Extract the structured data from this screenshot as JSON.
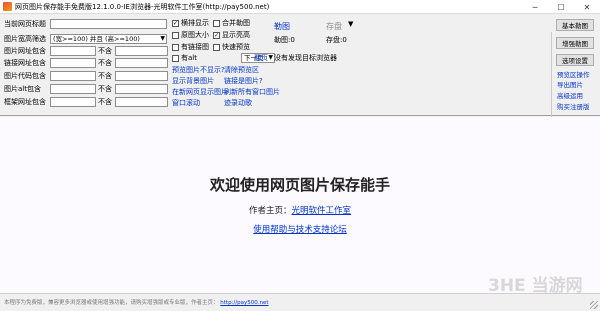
{
  "window": {
    "title": "网页图片保存能手免费版12.1.0.0-IE浏览器-光明软件工作室(http://pay500.net)",
    "min": "─",
    "max": "☐",
    "close": "✕"
  },
  "fields": {
    "url_label": "当前网页标题",
    "size_filter_label": "图片宽高筛选",
    "size_filter_value": "(宽>=100) 并且 (高>=100)",
    "img_url_contains_label": "图片网址包含",
    "link_url_contains_label": "链接网址包含",
    "img_code_contains_label": "图片代码包含",
    "img_alt_contains_label": "图片alt包含",
    "frame_url_contains_label": "框架网址包含",
    "not_contains": "不含"
  },
  "options": {
    "hide_display": "横排显示",
    "original_size": "原图大小",
    "link_thumbnail": "有链接图",
    "alt_text": "有alt",
    "merge_images": "合并勒图",
    "show_highlight": "显示亮高",
    "quick_preview": "快速预览",
    "page_select": "下一页",
    "next_link": "翻页",
    "hide_display_checked": true,
    "original_size_checked": false,
    "link_thumbnail_checked": false,
    "alt_text_checked": false,
    "merge_images_checked": false,
    "show_highlight_checked": true,
    "quick_preview_checked": false
  },
  "links": {
    "view_preview": "预览图片不显示?",
    "clear_preview": "清除预览区",
    "show_bg_images": "显示背景图片",
    "link_is_image": "链接是图片?",
    "show_in_new_window": "在新网页显示图片",
    "refresh_new_window": "刷新所有窗口图片",
    "window_scroll": "窗口滚动",
    "auto_scroll": "迹录动歌"
  },
  "status": {
    "grab_label": "勒图",
    "grab_count": "勒图:0",
    "save_label": "存盘",
    "save_count": "存盘:0",
    "no_target": "没有发现目标浏览器"
  },
  "right_buttons": {
    "basic": "基本勒图",
    "enhanced": "增强勒图",
    "options": "选项设置"
  },
  "right_links": {
    "preview_area": "预览区操作",
    "export_images": "导出图片",
    "advanced": "高级运用",
    "buy": "购买注册版"
  },
  "content": {
    "headline": "欢迎使用网页图片保存能手",
    "author_prefix": "作者主页：",
    "author_link": "光明软件工作室",
    "help_link": "使用帮助与技术支持论坛"
  },
  "statusbar": {
    "text": "本程序为免费版，兼容更多浏览器或使用增强功能，请购买增强版或专业版，作者主页：",
    "url": "http://pay500.net"
  },
  "watermark": "3HE 当游网"
}
